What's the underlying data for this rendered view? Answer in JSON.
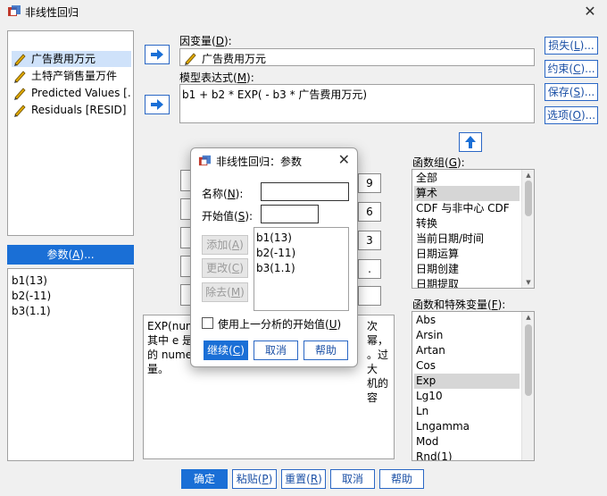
{
  "window": {
    "title": "非线性回归"
  },
  "variables": [
    {
      "label": "广告费用万元",
      "selected": true
    },
    {
      "label": "土特产销售量万件",
      "selected": false
    },
    {
      "label": "Predicted Values [...",
      "selected": false
    },
    {
      "label": "Residuals [RESID]",
      "selected": false
    }
  ],
  "dependent": {
    "label_prefix": "因变量(",
    "label_key": "D",
    "label_suffix": "):",
    "value": "广告费用万元"
  },
  "model": {
    "label_prefix": "模型表达式(",
    "label_key": "M",
    "label_suffix": "):",
    "value": "b1 + b2 * EXP( - b3 * 广告费用万元)"
  },
  "side_buttons": [
    {
      "prefix": "损失(",
      "key": "L",
      "suffix": ")..."
    },
    {
      "prefix": "约束(",
      "key": "C",
      "suffix": ")..."
    },
    {
      "prefix": "保存(",
      "key": "S",
      "suffix": ")..."
    },
    {
      "prefix": "选项(",
      "key": "O",
      "suffix": ")..."
    }
  ],
  "params": {
    "header_prefix": "参数(",
    "header_key": "A",
    "header_suffix": ")...",
    "items": [
      "b1(13)",
      "b2(-11)",
      "b3(1.1)"
    ]
  },
  "calc_keys": [
    "9",
    "6",
    "3",
    "."
  ],
  "function_groups": {
    "label_prefix": "函数组(",
    "label_key": "G",
    "label_suffix": "):",
    "items": [
      "全部",
      "算术",
      "CDF 与非中心 CDF",
      "转换",
      "当前日期/时间",
      "日期运算",
      "日期创建",
      "日期提取"
    ],
    "selected_index": 1
  },
  "functions": {
    "label_prefix": "函数和特殊变量(",
    "label_key": "F",
    "label_suffix": "):",
    "items": [
      "Abs",
      "Arsin",
      "Artan",
      "Cos",
      "Exp",
      "Lg10",
      "Ln",
      "Lngamma",
      "Mod",
      "Rnd(1)"
    ],
    "selected_index": 4
  },
  "description": {
    "lines": [
      "EXP(num",
      "其中 e 是",
      "的 numex",
      "量。"
    ],
    "right_lines": [
      "次幂，",
      "。过大",
      "机的容"
    ]
  },
  "bottom_buttons": {
    "ok": "确定",
    "paste": {
      "prefix": "粘贴(",
      "key": "P",
      "suffix": ")"
    },
    "reset": {
      "prefix": "重置(",
      "key": "R",
      "suffix": ")"
    },
    "cancel": "取消",
    "help": "帮助"
  },
  "dialog": {
    "title": "非线性回归：参数",
    "name_label": {
      "prefix": "名称(",
      "key": "N",
      "suffix": "):"
    },
    "name_value": "",
    "start_label": {
      "prefix": "开始值(",
      "key": "S",
      "suffix": "):"
    },
    "start_value": "",
    "add": {
      "prefix": "添加(",
      "key": "A",
      "suffix": ")"
    },
    "change": {
      "prefix": "更改(",
      "key": "C",
      "suffix": ")"
    },
    "remove": {
      "prefix": "除去(",
      "key": "M",
      "suffix": ")"
    },
    "items": [
      "b1(13)",
      "b2(-11)",
      "b3(1.1)"
    ],
    "checkbox": {
      "prefix": "使用上一分析的开始值(",
      "key": "U",
      "suffix": ")"
    },
    "continue": {
      "prefix": "继续(",
      "key": "C",
      "suffix": ")"
    },
    "cancel": "取消",
    "help": "帮助"
  },
  "colors": {
    "accent": "#1a6fd6",
    "selection": "#cfe2fa",
    "list_selection": "#d6d6d6"
  }
}
